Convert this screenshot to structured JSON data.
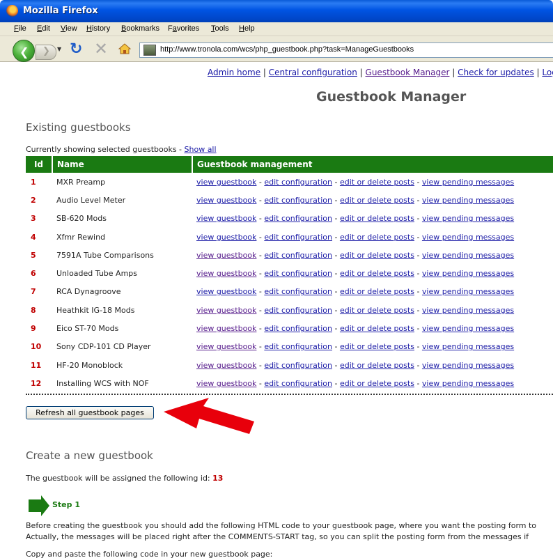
{
  "window": {
    "title": "Mozilla Firefox"
  },
  "menu": [
    "File",
    "Edit",
    "View",
    "History",
    "Bookmarks",
    "Favorites",
    "Tools",
    "Help"
  ],
  "menu_keys": [
    "F",
    "E",
    "V",
    "H",
    "B",
    "a",
    "T",
    "H"
  ],
  "address": {
    "url": "http://www.tronola.com/wcs/php_guestbook.php?task=ManageGuestbooks"
  },
  "toplinks": {
    "admin_home": "Admin home",
    "central_config": "Central configuration",
    "guestbook_manager": "Guestbook Manager",
    "check_updates": "Check for updates",
    "logout": "Logout",
    "separator": " | "
  },
  "page": {
    "title": "Guestbook Manager",
    "existing_title": "Existing guestbooks",
    "showing_text": "Currently showing selected guestbooks - ",
    "show_all": "Show all",
    "refresh_button": "Refresh all guestbook pages",
    "create_title": "Create a new guestbook",
    "assigned_text": "The guestbook will be assigned the following id: ",
    "next_id": "13",
    "step_label": "Step 1",
    "para1": "Before creating the guestbook you should add the following HTML code to your guestbook page, where you want the posting form to",
    "para2": "Actually, the messages will be placed right after the COMMENTS-START tag, so you can split the posting form from the messages if",
    "para3": "Copy and paste the following code in your new guestbook page:"
  },
  "table": {
    "headers": {
      "id": "Id",
      "name": "Name",
      "management": "Guestbook management"
    },
    "actions": {
      "view": "view guestbook",
      "edit_config": "edit configuration",
      "edit_posts": "edit or delete posts",
      "pending": "view pending messages",
      "sep": " - "
    },
    "rows": [
      {
        "id": "1",
        "name": "MXR Preamp"
      },
      {
        "id": "2",
        "name": "Audio Level Meter"
      },
      {
        "id": "3",
        "name": "SB-620 Mods"
      },
      {
        "id": "4",
        "name": "Xfmr Rewind"
      },
      {
        "id": "5",
        "name": "7591A Tube Comparisons"
      },
      {
        "id": "6",
        "name": "Unloaded Tube Amps"
      },
      {
        "id": "7",
        "name": "RCA Dynagroove"
      },
      {
        "id": "8",
        "name": "Heathkit IG-18 Mods"
      },
      {
        "id": "9",
        "name": "Eico ST-70 Mods"
      },
      {
        "id": "10",
        "name": "Sony CDP-101 CD Player"
      },
      {
        "id": "11",
        "name": "HF-20 Monoblock"
      },
      {
        "id": "12",
        "name": "Installing WCS with NOF"
      }
    ]
  },
  "colors": {
    "header_green": "#1a7a12",
    "id_red": "#c00000",
    "arrow_red": "#e8000b",
    "link_blue": "#1a1aa6"
  }
}
